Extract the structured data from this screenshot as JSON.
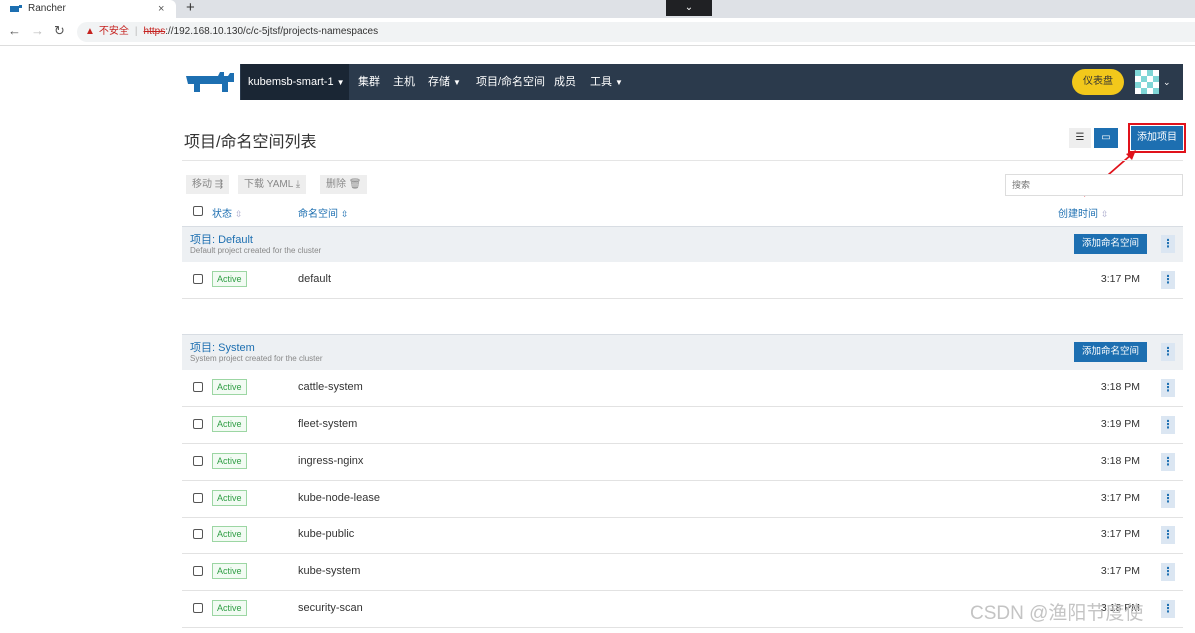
{
  "browser": {
    "tab_title": "Rancher",
    "tab_close": "×",
    "new_tab": "+",
    "url_insecure_label": "不安全",
    "url_scheme": "https",
    "url_rest": "://192.168.10.130/c/c-5jtsf/projects-namespaces"
  },
  "header": {
    "cluster": "kubemsb-smart-1",
    "nav": [
      "集群",
      "主机",
      "存储",
      "项目/命名空间",
      "成员",
      "工具"
    ],
    "dashboard_button": "仪表盘"
  },
  "page": {
    "title": "项目/命名空间列表",
    "add_project": "添加项目",
    "bulk": {
      "move": "移动",
      "download": "下载 YAML",
      "delete": "删除"
    },
    "search_placeholder": "搜索",
    "columns": {
      "state": "状态",
      "namespace": "命名空间",
      "created": "创建时间"
    }
  },
  "groups": [
    {
      "title": "项目: Default",
      "description": "Default project created for the cluster",
      "add_namespace": "添加命名空间",
      "rows": [
        {
          "state": "Active",
          "name": "default",
          "time": "3:17 PM"
        }
      ]
    },
    {
      "title": "项目: System",
      "description": "System project created for the cluster",
      "add_namespace": "添加命名空间",
      "rows": [
        {
          "state": "Active",
          "name": "cattle-system",
          "time": "3:18 PM"
        },
        {
          "state": "Active",
          "name": "fleet-system",
          "time": "3:19 PM"
        },
        {
          "state": "Active",
          "name": "ingress-nginx",
          "time": "3:18 PM"
        },
        {
          "state": "Active",
          "name": "kube-node-lease",
          "time": "3:17 PM"
        },
        {
          "state": "Active",
          "name": "kube-public",
          "time": "3:17 PM"
        },
        {
          "state": "Active",
          "name": "kube-system",
          "time": "3:17 PM"
        },
        {
          "state": "Active",
          "name": "security-scan",
          "time": "3:18 PM"
        }
      ]
    }
  ],
  "watermark": "CSDN @渔阳节度使",
  "colors": {
    "nav_bg": "#2b3a4c",
    "primary": "#1d6fb1",
    "dashboard": "#f2c81b",
    "highlight": "#e0121b"
  }
}
